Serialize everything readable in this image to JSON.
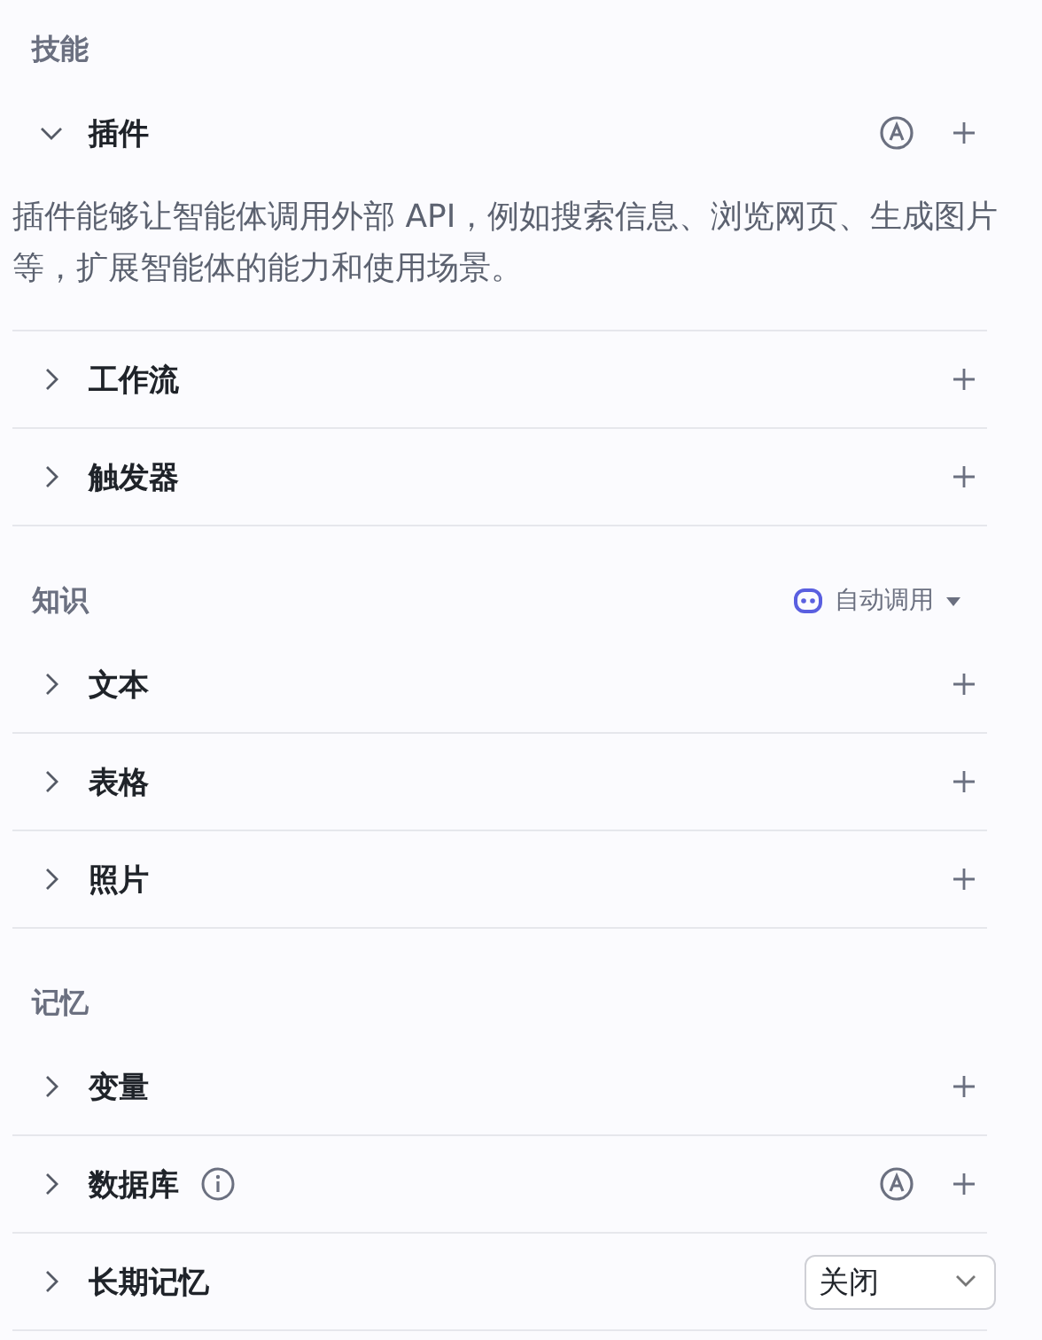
{
  "sections": [
    {
      "title": "技能",
      "items": [
        {
          "label": "插件",
          "expanded": true,
          "auto": true,
          "info": false,
          "description": "插件能够让智能体调用外部 API，例如搜索信息、浏览网页、生成图片等，扩展智能体的能力和使用场景。"
        },
        {
          "label": "工作流",
          "expanded": false,
          "auto": false,
          "info": false
        },
        {
          "label": "触发器",
          "expanded": false,
          "auto": false,
          "info": false
        }
      ]
    },
    {
      "title": "知识",
      "mode": "自动调用",
      "items": [
        {
          "label": "文本",
          "expanded": false,
          "auto": false,
          "info": false
        },
        {
          "label": "表格",
          "expanded": false,
          "auto": false,
          "info": false
        },
        {
          "label": "照片",
          "expanded": false,
          "auto": false,
          "info": false
        }
      ]
    },
    {
      "title": "记忆",
      "items": [
        {
          "label": "变量",
          "expanded": false,
          "auto": false,
          "info": false
        },
        {
          "label": "数据库",
          "expanded": false,
          "auto": true,
          "info": true
        },
        {
          "label": "长期记忆",
          "expanded": false,
          "auto": false,
          "info": false,
          "select": {
            "value": "关闭"
          }
        }
      ]
    }
  ]
}
